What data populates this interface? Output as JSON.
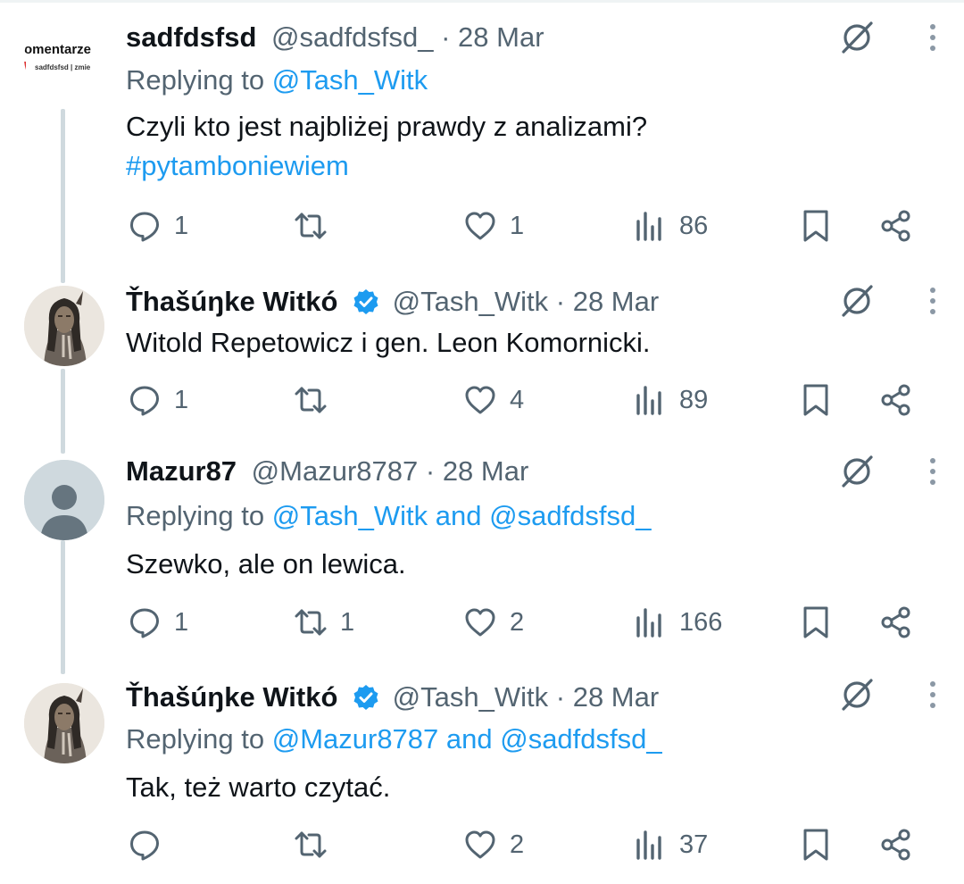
{
  "tweets": [
    {
      "name": "sadfdsfsd",
      "handle": "@sadfdsfsd_",
      "date": "28 Mar",
      "verified": false,
      "avatar": "logo-avatar",
      "avatar_logo_text": {
        "top": "omentarze",
        "bottom": "sadfdsfsd | zmie"
      },
      "reply_prefix": "Replying to",
      "reply_to": "@Tash_Witk",
      "text_lines": [
        "Czyli kto jest najbliżej prawdy z analizami?"
      ],
      "hashtag": "#pytamboniewiem",
      "replies": "1",
      "retweets": "",
      "likes": "1",
      "views": "86"
    },
    {
      "name": "Ťhašúŋke Witkó",
      "handle": "@Tash_Witk",
      "date": "28 Mar",
      "verified": true,
      "avatar": "portrait-avatar",
      "text_lines": [
        "Witold Repetowicz i gen. Leon Komornicki."
      ],
      "replies": "1",
      "retweets": "",
      "likes": "4",
      "views": "89"
    },
    {
      "name": "Mazur87",
      "handle": "@Mazur8787",
      "date": "28 Mar",
      "verified": false,
      "avatar": "default-avatar",
      "reply_prefix": "Replying to",
      "reply_to": "@Tash_Witk and @sadfdsfsd_",
      "text_lines": [
        "Szewko, ale on lewica."
      ],
      "replies": "1",
      "retweets": "1",
      "likes": "2",
      "views": "166"
    },
    {
      "name": "Ťhašúŋke Witkó",
      "handle": "@Tash_Witk",
      "date": "28 Mar",
      "verified": true,
      "avatar": "portrait-avatar",
      "reply_prefix": "Replying to",
      "reply_to": "@Mazur8787 and @sadfdsfsd_",
      "text_lines": [
        "Tak, też warto czytać."
      ],
      "replies": "",
      "retweets": "",
      "likes": "2",
      "views": "37"
    }
  ],
  "separator": "·",
  "colors": {
    "text": "#0f1419",
    "secondary": "#536471",
    "link": "#1d9bf0",
    "thread_line": "#cfd9de",
    "verified": "#1d9bf0"
  },
  "icons": [
    "grok-icon",
    "more-icon",
    "reply-icon",
    "retweet-icon",
    "like-icon",
    "views-icon",
    "bookmark-icon",
    "share-icon",
    "verified-icon"
  ]
}
